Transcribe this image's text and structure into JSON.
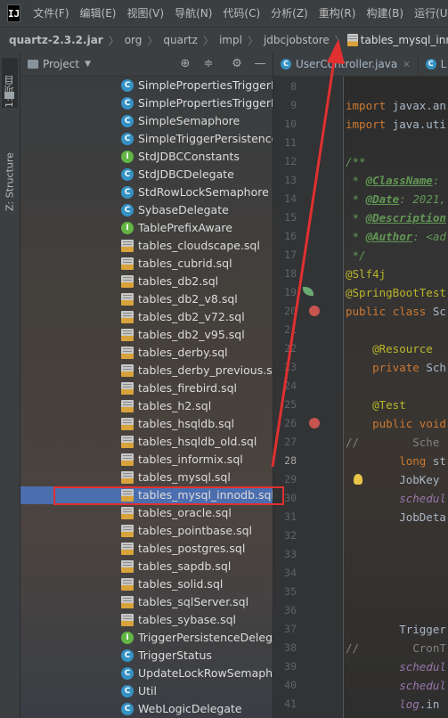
{
  "menubar": {
    "items": [
      "文件(F)",
      "编辑(E)",
      "视图(V)",
      "导航(N)",
      "代码(C)",
      "分析(Z)",
      "重构(R)",
      "构建(B)",
      "运行(U)"
    ]
  },
  "breadcrumb": {
    "items": [
      "quartz-2.3.2.jar",
      "org",
      "quartz",
      "impl",
      "jdbcjobstore"
    ],
    "file": "tables_mysql_innodb.sql"
  },
  "left_strip": {
    "project_tab": "1: 项目",
    "structure_tab": "Z: Structure"
  },
  "project_panel": {
    "title": "Project",
    "items": [
      {
        "label": "SimplePropertiesTriggerPe",
        "type": "class"
      },
      {
        "label": "SimplePropertiesTriggerPe",
        "type": "class"
      },
      {
        "label": "SimpleSemaphore",
        "type": "class"
      },
      {
        "label": "SimpleTriggerPersistenceD",
        "type": "class"
      },
      {
        "label": "StdJDBCConstants",
        "type": "interface"
      },
      {
        "label": "StdJDBCDelegate",
        "type": "class"
      },
      {
        "label": "StdRowLockSemaphore",
        "type": "class"
      },
      {
        "label": "SybaseDelegate",
        "type": "class"
      },
      {
        "label": "TablePrefixAware",
        "type": "interface"
      },
      {
        "label": "tables_cloudscape.sql",
        "type": "sql"
      },
      {
        "label": "tables_cubrid.sql",
        "type": "sql"
      },
      {
        "label": "tables_db2.sql",
        "type": "sql"
      },
      {
        "label": "tables_db2_v8.sql",
        "type": "sql"
      },
      {
        "label": "tables_db2_v72.sql",
        "type": "sql"
      },
      {
        "label": "tables_db2_v95.sql",
        "type": "sql"
      },
      {
        "label": "tables_derby.sql",
        "type": "sql"
      },
      {
        "label": "tables_derby_previous.sql",
        "type": "sql"
      },
      {
        "label": "tables_firebird.sql",
        "type": "sql"
      },
      {
        "label": "tables_h2.sql",
        "type": "sql"
      },
      {
        "label": "tables_hsqldb.sql",
        "type": "sql"
      },
      {
        "label": "tables_hsqldb_old.sql",
        "type": "sql"
      },
      {
        "label": "tables_informix.sql",
        "type": "sql"
      },
      {
        "label": "tables_mysql.sql",
        "type": "sql"
      },
      {
        "label": "tables_mysql_innodb.sql",
        "type": "sql",
        "selected": true
      },
      {
        "label": "tables_oracle.sql",
        "type": "sql"
      },
      {
        "label": "tables_pointbase.sql",
        "type": "sql"
      },
      {
        "label": "tables_postgres.sql",
        "type": "sql"
      },
      {
        "label": "tables_sapdb.sql",
        "type": "sql"
      },
      {
        "label": "tables_solid.sql",
        "type": "sql"
      },
      {
        "label": "tables_sqlServer.sql",
        "type": "sql"
      },
      {
        "label": "tables_sybase.sql",
        "type": "sql"
      },
      {
        "label": "TriggerPersistenceDelegat",
        "type": "interface"
      },
      {
        "label": "TriggerStatus",
        "type": "class"
      },
      {
        "label": "UpdateLockRowSemaphor",
        "type": "class"
      },
      {
        "label": "Util",
        "type": "class"
      },
      {
        "label": "WebLogicDelegate",
        "type": "class"
      }
    ]
  },
  "editor": {
    "tabs": [
      {
        "label": "UserController.java",
        "close": "×"
      },
      {
        "label": "L",
        "close": ""
      }
    ],
    "current_line": "28",
    "lines": [
      {
        "n": "8",
        "text": ""
      },
      {
        "n": "9",
        "text": "import javax.an"
      },
      {
        "n": "10",
        "text": "import java.uti"
      },
      {
        "n": "11",
        "text": ""
      },
      {
        "n": "12",
        "text": "/**"
      },
      {
        "n": "13",
        "text": " * @ClassName:"
      },
      {
        "n": "14",
        "text": " * @Date: 2021,"
      },
      {
        "n": "15",
        "text": " * @Description"
      },
      {
        "n": "16",
        "text": " * @Author: <ad"
      },
      {
        "n": "17",
        "text": " */"
      },
      {
        "n": "18",
        "text": "@Slf4j"
      },
      {
        "n": "19",
        "text": "@SpringBootTest"
      },
      {
        "n": "20",
        "text": "public class Sc"
      },
      {
        "n": "21",
        "text": ""
      },
      {
        "n": "22",
        "text": "    @Resource"
      },
      {
        "n": "23",
        "text": "    private Sch"
      },
      {
        "n": "24",
        "text": ""
      },
      {
        "n": "25",
        "text": "    @Test"
      },
      {
        "n": "26",
        "text": "    public void"
      },
      {
        "n": "27",
        "text": "//        Sche"
      },
      {
        "n": "28",
        "text": "        long st"
      },
      {
        "n": "29",
        "text": "        JobKey"
      },
      {
        "n": "30",
        "text": "        schedul"
      },
      {
        "n": "31",
        "text": "        JobDeta"
      },
      {
        "n": "32",
        "text": ""
      },
      {
        "n": "33",
        "text": ""
      },
      {
        "n": "34",
        "text": ""
      },
      {
        "n": "35",
        "text": ""
      },
      {
        "n": "36",
        "text": ""
      },
      {
        "n": "37",
        "text": "        Trigger"
      },
      {
        "n": "38",
        "text": "//        CronT"
      },
      {
        "n": "39",
        "text": "        schedul"
      },
      {
        "n": "40",
        "text": "        schedul"
      },
      {
        "n": "41",
        "text": "        log.in"
      }
    ]
  }
}
